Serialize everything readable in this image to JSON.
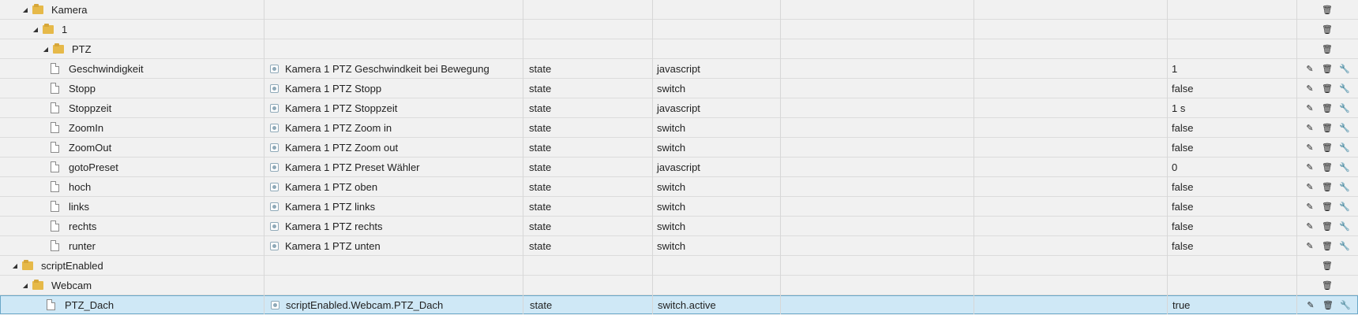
{
  "rows": [
    {
      "name": "Kamera",
      "level": 1,
      "kind": "folder",
      "expanded": true,
      "desc": "",
      "type": "",
      "role": "",
      "value": "",
      "actions": [
        "delete"
      ]
    },
    {
      "name": "1",
      "level": 2,
      "kind": "folder",
      "expanded": true,
      "desc": "",
      "type": "",
      "role": "",
      "value": "",
      "actions": [
        "delete"
      ]
    },
    {
      "name": "PTZ",
      "level": 3,
      "kind": "folder",
      "expanded": true,
      "desc": "",
      "type": "",
      "role": "",
      "value": "",
      "actions": [
        "delete"
      ]
    },
    {
      "name": "Geschwindigkeit",
      "level": 4,
      "kind": "state",
      "desc": "Kamera 1 PTZ Geschwindkeit bei Bewegung",
      "type": "state",
      "role": "javascript",
      "value": "1",
      "actions": [
        "edit",
        "delete",
        "settings"
      ]
    },
    {
      "name": "Stopp",
      "level": 4,
      "kind": "state",
      "desc": "Kamera 1 PTZ Stopp",
      "type": "state",
      "role": "switch",
      "value": "false",
      "actions": [
        "edit",
        "delete",
        "settings"
      ]
    },
    {
      "name": "Stoppzeit",
      "level": 4,
      "kind": "state",
      "desc": "Kamera 1 PTZ Stoppzeit",
      "type": "state",
      "role": "javascript",
      "value": "1 s",
      "actions": [
        "edit",
        "delete",
        "settings"
      ]
    },
    {
      "name": "ZoomIn",
      "level": 4,
      "kind": "state",
      "desc": "Kamera 1 PTZ Zoom in",
      "type": "state",
      "role": "switch",
      "value": "false",
      "actions": [
        "edit",
        "delete",
        "settings"
      ]
    },
    {
      "name": "ZoomOut",
      "level": 4,
      "kind": "state",
      "desc": "Kamera 1 PTZ Zoom out",
      "type": "state",
      "role": "switch",
      "value": "false",
      "actions": [
        "edit",
        "delete",
        "settings"
      ]
    },
    {
      "name": "gotoPreset",
      "level": 4,
      "kind": "state",
      "desc": "Kamera 1 PTZ Preset Wähler",
      "type": "state",
      "role": "javascript",
      "value": "0",
      "actions": [
        "edit",
        "delete",
        "settings"
      ]
    },
    {
      "name": "hoch",
      "level": 4,
      "kind": "state",
      "desc": "Kamera 1 PTZ oben",
      "type": "state",
      "role": "switch",
      "value": "false",
      "actions": [
        "edit",
        "delete",
        "settings"
      ]
    },
    {
      "name": "links",
      "level": 4,
      "kind": "state",
      "desc": "Kamera 1 PTZ links",
      "type": "state",
      "role": "switch",
      "value": "false",
      "actions": [
        "edit",
        "delete",
        "settings"
      ]
    },
    {
      "name": "rechts",
      "level": 4,
      "kind": "state",
      "desc": "Kamera 1 PTZ rechts",
      "type": "state",
      "role": "switch",
      "value": "false",
      "actions": [
        "edit",
        "delete",
        "settings"
      ]
    },
    {
      "name": "runter",
      "level": 4,
      "kind": "state",
      "desc": "Kamera 1 PTZ unten",
      "type": "state",
      "role": "switch",
      "value": "false",
      "actions": [
        "edit",
        "delete",
        "settings"
      ]
    },
    {
      "name": "scriptEnabled",
      "level": 0,
      "kind": "folder",
      "expanded": true,
      "desc": "",
      "type": "",
      "role": "",
      "value": "",
      "actions": [
        "delete"
      ]
    },
    {
      "name": "Webcam",
      "level": 1,
      "kind": "folder",
      "expanded": true,
      "desc": "",
      "type": "",
      "role": "",
      "value": "",
      "actions": [
        "delete"
      ]
    },
    {
      "name": "PTZ_Dach",
      "level": 2,
      "kind": "state",
      "selected": true,
      "desc": "scriptEnabled.Webcam.PTZ_Dach",
      "type": "state",
      "role": "switch.active",
      "value": "true",
      "actions": [
        "edit",
        "delete",
        "settings"
      ]
    }
  ],
  "icons": {
    "expanded": "◢",
    "edit": "✎",
    "delete": "🗑",
    "settings": "🔧"
  }
}
